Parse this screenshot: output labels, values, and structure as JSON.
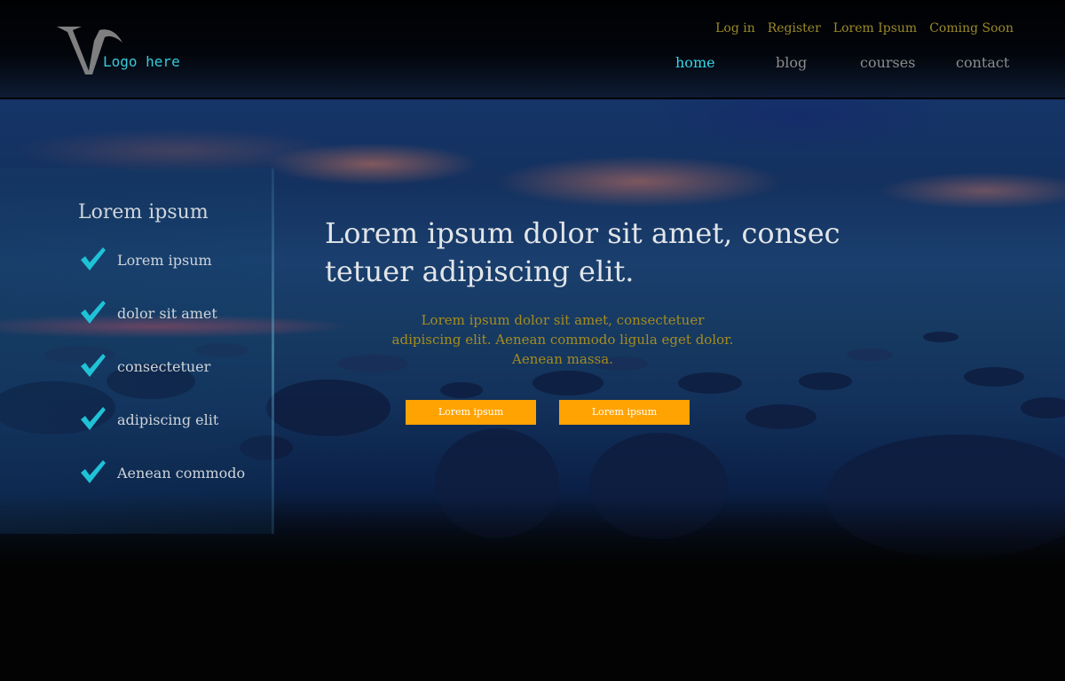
{
  "header": {
    "logo_text": "Logo here",
    "utility_links": [
      "Log in",
      "Register",
      "Lorem Ipsum",
      "Coming Soon"
    ],
    "nav": [
      {
        "label": "home",
        "active": true
      },
      {
        "label": "blog",
        "active": false
      },
      {
        "label": "courses",
        "active": false
      },
      {
        "label": "contact",
        "active": false
      }
    ]
  },
  "sidebar": {
    "title": "Lorem ipsum",
    "items": [
      "Lorem ipsum",
      "dolor sit amet",
      "consectetuer",
      "adipiscing elit",
      "Aenean commodo"
    ],
    "icon": "checkmark-icon"
  },
  "main": {
    "title": "Lorem ipsum dolor sit amet, consec tetuer adipiscing elit.",
    "title_line1": "Lorem ipsum dolor sit amet, consec",
    "title_line2": "tetuer adipiscing elit.",
    "body_line1": "Lorem ipsum dolor sit amet, consectetuer",
    "body_line2": "adipiscing elit. Aenean commodo ligula eget dolor.",
    "body_line3": "Aenean massa.",
    "buttons": [
      "Lorem ipsum",
      "Lorem ipsum"
    ]
  },
  "colors": {
    "accent_cyan": "#33d6e6",
    "button_orange": "#ffa303",
    "util_link_olive": "#9a8a2a",
    "body_text_gold": "#a68c1e"
  }
}
